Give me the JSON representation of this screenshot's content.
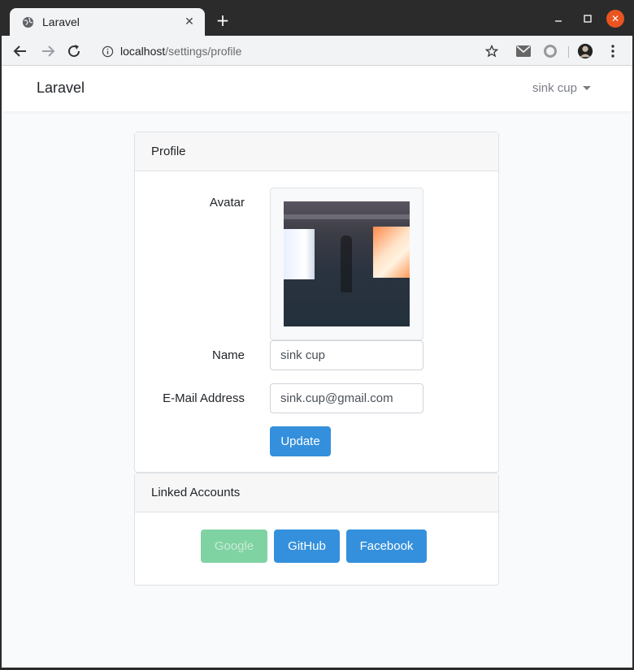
{
  "browser": {
    "tab_title": "Laravel",
    "url_host": "localhost",
    "url_path": "/settings/profile",
    "icons": [
      "globe-icon",
      "close-icon",
      "plus-icon",
      "minimize-icon",
      "maximize-icon",
      "window-close-icon",
      "back-icon",
      "forward-icon",
      "reload-icon",
      "info-icon",
      "star-icon",
      "mail-icon",
      "circle-icon",
      "profile-icon",
      "kebab-menu-icon"
    ]
  },
  "navbar": {
    "brand": "Laravel",
    "user_name": "sink cup"
  },
  "profile": {
    "header": "Profile",
    "avatar_label": "Avatar",
    "name_label": "Name",
    "name_value": "sink cup",
    "email_label": "E-Mail Address",
    "email_value": "sink.cup@gmail.com",
    "update_label": "Update"
  },
  "linked": {
    "header": "Linked Accounts",
    "google_label": "Google",
    "github_label": "GitHub",
    "facebook_label": "Facebook"
  },
  "colors": {
    "primary": "#3490dc",
    "google_disabled": "#7fd3a3",
    "close_button": "#e95420"
  }
}
